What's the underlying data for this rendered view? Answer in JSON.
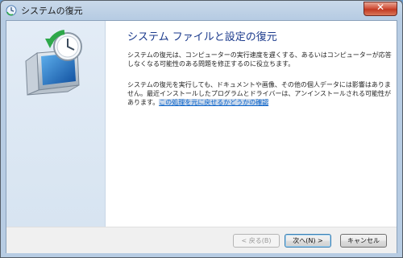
{
  "window": {
    "title": "システムの復元"
  },
  "main": {
    "heading": "システム ファイルと設定の復元",
    "para1": "システムの復元は、コンピューターの実行速度を遅くする、あるいはコンピューターが応答しなくなる可能性のある問題を修正するのに役立ちます。",
    "para2": "システムの復元を実行しても、ドキュメントや画像、その他の個人データには影響はありません。最近インストールしたプログラムとドライバーは、アンインストールされる可能性があります。",
    "link": "この処理を元に戻せるかどうかの確認"
  },
  "buttons": {
    "back": "< 戻る(B)",
    "next": "次へ(N) >",
    "cancel": "キャンセル"
  },
  "icons": {
    "title": "system-restore-icon",
    "hero": "system-restore-clock-icon",
    "close": "close-icon"
  }
}
